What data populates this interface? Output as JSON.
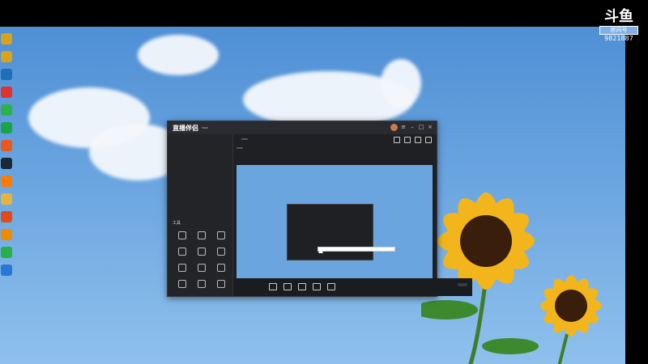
{
  "watermark": {
    "logo": "斗鱼",
    "room_label": "房间号",
    "room_number": "9821887"
  },
  "desktop_icons": [
    {
      "label": "",
      "color": "#d9a21c"
    },
    {
      "label": "",
      "color": "#d9a21c"
    },
    {
      "label": "",
      "color": "#1d6fb8"
    },
    {
      "label": "",
      "color": "#e0322f"
    },
    {
      "label": "",
      "color": "#2bb24c"
    },
    {
      "label": "",
      "color": "#1aa34a"
    },
    {
      "label": "",
      "color": "#e85a1c"
    },
    {
      "label": "",
      "color": "#1b2838"
    },
    {
      "label": "",
      "color": "#ff7a00"
    },
    {
      "label": "",
      "color": "#e6b43c"
    },
    {
      "label": "",
      "color": "#e24a1a"
    },
    {
      "label": "",
      "color": "#f08a00"
    },
    {
      "label": "",
      "color": "#27b04a"
    },
    {
      "label": "",
      "color": "#2a78d6"
    }
  ],
  "app": {
    "logo": "直播伴侣",
    "version": "",
    "tabs": [
      "",
      "",
      ""
    ],
    "scene": "",
    "tools_title": "工具",
    "tools": [
      "",
      "",
      "",
      "",
      "",
      "",
      "",
      "",
      "",
      "",
      "",
      ""
    ],
    "bottom_status": "",
    "top_title": "",
    "top_button": "",
    "sub_items": [
      "",
      "",
      ""
    ],
    "bottom_actions": [
      "",
      "",
      "",
      "",
      ""
    ],
    "start_label": ""
  },
  "tooltip": {
    "lines": [
      "",
      "",
      "",
      "",
      ""
    ]
  }
}
